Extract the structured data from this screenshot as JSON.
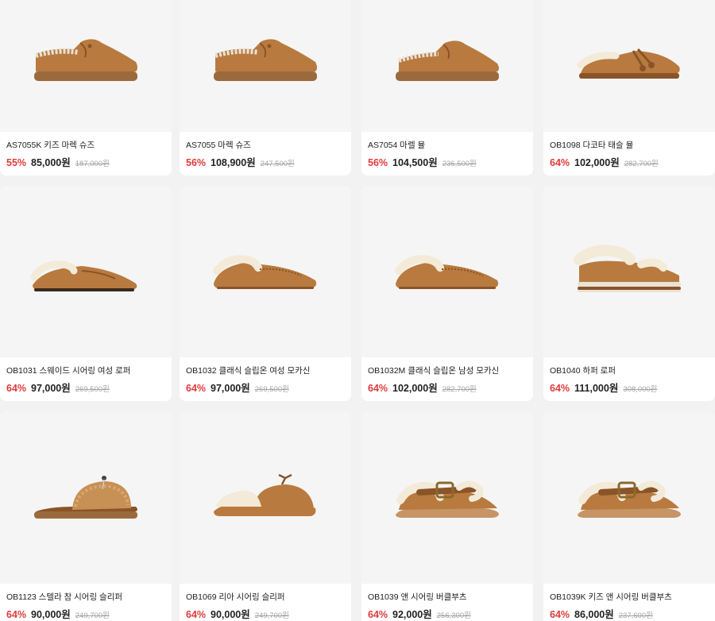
{
  "colors": {
    "discount": "#e03a3a",
    "card_bg": "#ffffff",
    "image_bg": "#f5f5f5",
    "page_bg": "#f2f2f2",
    "suede": "#b97a3f",
    "fleece": "#f3ead8"
  },
  "products": [
    {
      "name": "AS7055K 키즈 마렉 슈즈",
      "discount": "55%",
      "price": "85,000원",
      "original": "187,000원",
      "icon": "shoe-moc-laced"
    },
    {
      "name": "AS7055 마렉 슈즈",
      "discount": "56%",
      "price": "108,900원",
      "original": "247,500원",
      "icon": "shoe-moc-laced"
    },
    {
      "name": "AS7054 마렐 뮬",
      "discount": "56%",
      "price": "104,500원",
      "original": "236,500원",
      "icon": "mule-laced"
    },
    {
      "name": "OB1098 다코타 태슬 뮬",
      "discount": "64%",
      "price": "102,000원",
      "original": "282,700원",
      "icon": "mule-tassel"
    },
    {
      "name": "OB1031 스웨이드 시어링 여성 로퍼",
      "discount": "64%",
      "price": "97,000원",
      "original": "269,500원",
      "icon": "loafer-shearling"
    },
    {
      "name": "OB1032 클래식 슬립온 여성 모카신",
      "discount": "64%",
      "price": "97,000원",
      "original": "269,500원",
      "icon": "moccasin-shearling"
    },
    {
      "name": "OB1032M 클래식 슬립온 남성 모카신",
      "discount": "64%",
      "price": "102,000원",
      "original": "282,700원",
      "icon": "moccasin-shearling"
    },
    {
      "name": "OB1040 하퍼 로퍼",
      "discount": "64%",
      "price": "111,000원",
      "original": "308,000원",
      "icon": "platform-loafer"
    },
    {
      "name": "OB1123 스텔라 참 시어링 슬리퍼",
      "discount": "64%",
      "price": "90,000원",
      "original": "249,700원",
      "icon": "fluffy-slide"
    },
    {
      "name": "OB1069 리아 시어링 슬리퍼",
      "discount": "64%",
      "price": "90,000원",
      "original": "249,700원",
      "icon": "shearling-slipper"
    },
    {
      "name": "OB1039 앤 시어링 버클부츠",
      "discount": "64%",
      "price": "92,000원",
      "original": "256,300원",
      "icon": "buckle-clog"
    },
    {
      "name": "OB1039K 키즈 앤 시어링 버클부츠",
      "discount": "64%",
      "price": "86,000원",
      "original": "237,600원",
      "icon": "buckle-clog"
    }
  ]
}
